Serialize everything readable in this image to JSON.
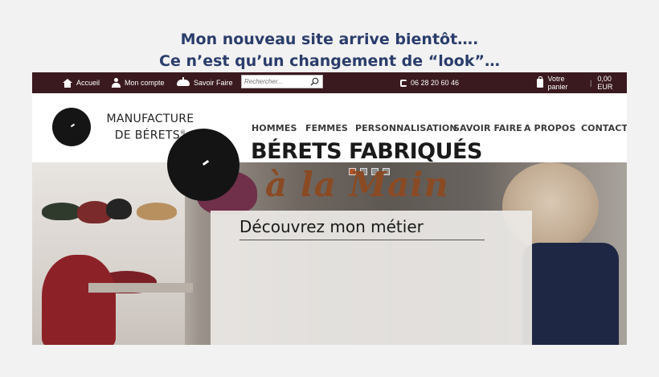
{
  "announcement": {
    "line1": "Mon nouveau site arrive bientôt….",
    "line2": "Ce n’est qu’un changement de “look”…"
  },
  "topbar": {
    "home_label": "Accueil",
    "account_label": "Mon compte",
    "savoir_label": "Savoir Faire",
    "search_placeholder": "Rechercher...",
    "phone": "06 28 20 60 46",
    "cart_label": "Votre panier",
    "cart_total": "0,00 EUR"
  },
  "brand": {
    "line1": "MANUFACTURE",
    "line2": "DE BÉRETS",
    "mark": "®"
  },
  "nav": {
    "items": [
      "HOMMES",
      "FEMMES",
      "PERSONNALISATION",
      "SAVOIR FAIRE",
      "A PROPOS",
      "CONTACTS"
    ]
  },
  "hero": {
    "slide_count": 4,
    "active_slide": 1,
    "headline": "BÉRETS FABRIQUÉS",
    "script": "à la Main",
    "cta": "Découvrez mon métier"
  },
  "colors": {
    "topbar_bg": "#3a1a1f",
    "announce_text": "#2a3d6b",
    "accent": "#8a4a23",
    "active_dot": "#b1562c"
  }
}
